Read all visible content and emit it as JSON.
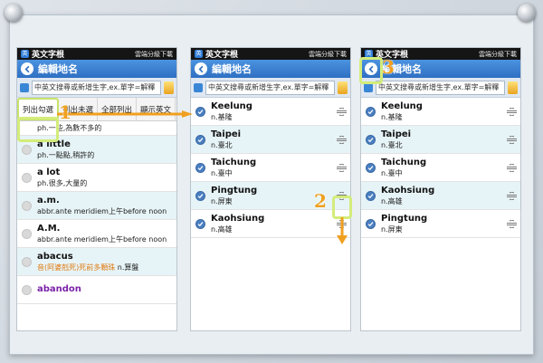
{
  "app": {
    "name": "英文字根",
    "cloud_download": "雲端分級下載",
    "page_title": "編輯地名",
    "search_placeholder": "中英文搜尋或新增生字,ex.單字=解釋"
  },
  "filters": [
    "列出勾選",
    "列出未選",
    "全部列出",
    "顯示英文"
  ],
  "phone1": {
    "partial_top_def": "ph.一些,為數不多的",
    "rows": [
      {
        "word": "a little",
        "def": "ph.一點點,稍許的"
      },
      {
        "word": "a lot",
        "def": "ph.很多,大量的"
      },
      {
        "word": "a.m.",
        "def": "abbr.ante meridiem上午before noon"
      },
      {
        "word": "A.M.",
        "def": "abbr.ante meridiem上午before noon"
      },
      {
        "word": "abacus",
        "def_orange": "音(阿婆剋死)死前多顆珠",
        "def_rest": "n.算盤"
      },
      {
        "word": "abandon",
        "def": ""
      }
    ]
  },
  "phone2": {
    "rows": [
      {
        "word": "Keelung",
        "def": "n.基隆"
      },
      {
        "word": "Taipei",
        "def": "n.臺北"
      },
      {
        "word": "Taichung",
        "def": "n.臺中"
      },
      {
        "word": "Pingtung",
        "def": "n.屏東"
      },
      {
        "word": "Kaohsiung",
        "def": "n.高雄"
      }
    ]
  },
  "phone3": {
    "rows": [
      {
        "word": "Keelung",
        "def": "n.基隆"
      },
      {
        "word": "Taipei",
        "def": "n.臺北"
      },
      {
        "word": "Taichung",
        "def": "n.臺中"
      },
      {
        "word": "Kaohsiung",
        "def": "n.高雄"
      },
      {
        "word": "Pingtung",
        "def": "n.屏東"
      }
    ]
  },
  "annotations": {
    "step1": "1",
    "step2": "2",
    "step3": "3"
  },
  "colors": {
    "accent": "#2f6fc2",
    "highlight": "#d3ec7a",
    "arrow": "#f0a020"
  }
}
